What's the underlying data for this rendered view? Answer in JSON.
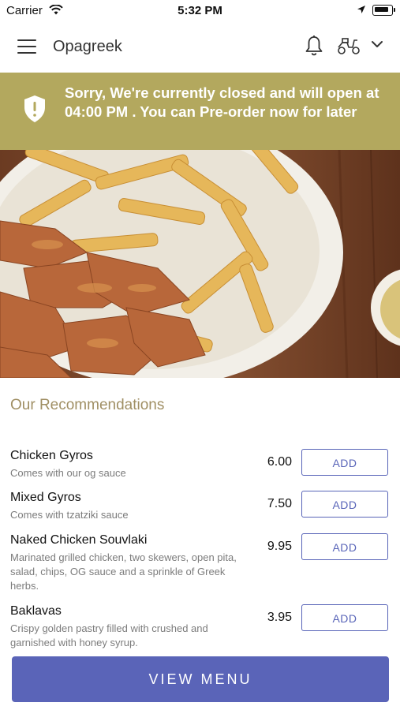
{
  "status_bar": {
    "carrier": "Carrier",
    "time": "5:32 PM"
  },
  "nav": {
    "title": "Opagreek"
  },
  "banner": {
    "message": "Sorry, We're currently closed and will open at 04:00 PM . You can Pre-order now for later"
  },
  "recommendations": {
    "title": "Our Recommendations",
    "add_label": "ADD",
    "items": [
      {
        "name": "Chicken Gyros",
        "description": "Comes with our og sauce",
        "price": "6.00"
      },
      {
        "name": "Mixed Gyros",
        "description": "Comes with tzatziki sauce",
        "price": "7.50"
      },
      {
        "name": "Naked Chicken Souvlaki",
        "description": "Marinated grilled chicken, two skewers, open pita, salad, chips, OG sauce and a sprinkle of Greek herbs.",
        "price": "9.95"
      },
      {
        "name": "Baklavas",
        "description": "Crispy golden pastry filled with crushed and garnished with honey syrup.",
        "price": "3.95"
      }
    ]
  },
  "footer": {
    "view_menu_label": "VIEW MENU"
  },
  "colors": {
    "banner": "#b3a85e",
    "accent": "#5a64b8",
    "section_title": "#a08f64"
  }
}
